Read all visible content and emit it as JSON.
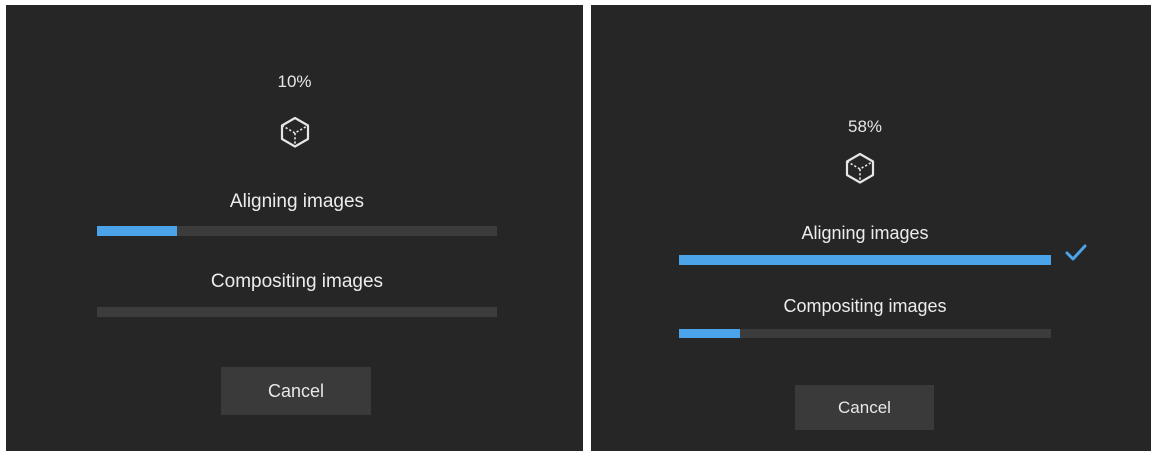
{
  "panels": [
    {
      "percent": "10%",
      "status_icon": "cube-icon",
      "steps": [
        {
          "label": "Aligning images",
          "progress": 0.2,
          "complete": false
        },
        {
          "label": "Compositing images",
          "progress": 0.0,
          "complete": false
        }
      ],
      "cancel_label": "Cancel"
    },
    {
      "percent": "58%",
      "status_icon": "cube-icon",
      "steps": [
        {
          "label": "Aligning images",
          "progress": 1.0,
          "complete": true
        },
        {
          "label": "Compositing images",
          "progress": 0.165,
          "complete": false
        }
      ],
      "cancel_label": "Cancel"
    }
  ],
  "colors": {
    "background": "#262626",
    "track": "#3c3c3c",
    "accent": "#4ba3ea",
    "button": "#3a3a3a"
  }
}
